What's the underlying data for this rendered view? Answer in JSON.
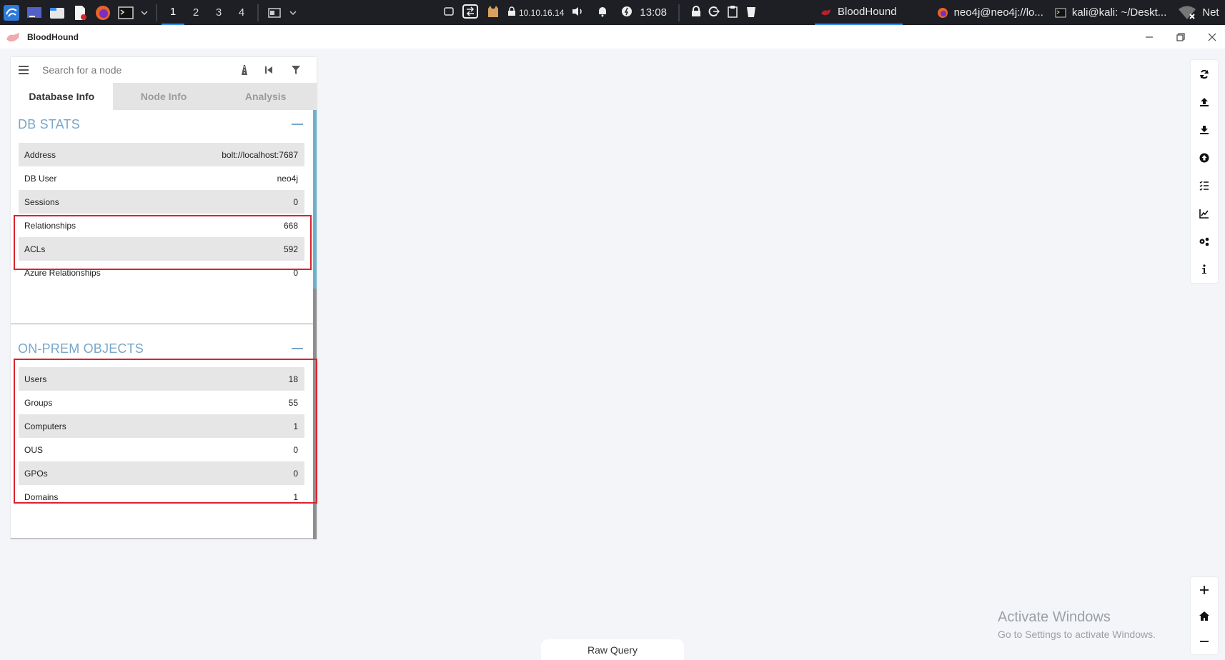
{
  "taskbar": {
    "workspaces": [
      "1",
      "2",
      "3",
      "4"
    ],
    "ip": "10.10.16.14",
    "time": "13:08",
    "tasks": [
      {
        "label": "BloodHound",
        "icon": "bloodhound-icon"
      },
      {
        "label": "neo4j@neo4j://lo...",
        "icon": "firefox-icon"
      },
      {
        "label": "kali@kali: ~/Deskt...",
        "icon": "terminal-icon"
      },
      {
        "label": "Net",
        "icon": "network-icon"
      }
    ]
  },
  "window": {
    "title": "BloodHound"
  },
  "search": {
    "placeholder": "Search for a node"
  },
  "tabs": [
    {
      "label": "Database Info"
    },
    {
      "label": "Node Info"
    },
    {
      "label": "Analysis"
    }
  ],
  "db_stats": {
    "title": "DB STATS",
    "rows": [
      {
        "label": "Address",
        "value": "bolt://localhost:7687"
      },
      {
        "label": "DB User",
        "value": "neo4j"
      },
      {
        "label": "Sessions",
        "value": "0"
      },
      {
        "label": "Relationships",
        "value": "668"
      },
      {
        "label": "ACLs",
        "value": "592"
      },
      {
        "label": "Azure Relationships",
        "value": "0"
      }
    ]
  },
  "onprem": {
    "title": "ON-PREM OBJECTS",
    "rows": [
      {
        "label": "Users",
        "value": "18"
      },
      {
        "label": "Groups",
        "value": "55"
      },
      {
        "label": "Computers",
        "value": "1"
      },
      {
        "label": "OUS",
        "value": "0"
      },
      {
        "label": "GPOs",
        "value": "0"
      },
      {
        "label": "Domains",
        "value": "1"
      }
    ]
  },
  "raw_query": {
    "label": "Raw Query"
  },
  "watermark": {
    "line1": "Activate Windows",
    "line2": "Go to Settings to activate Windows."
  },
  "colors": {
    "accent": "#78a7c9",
    "highlight": "#d9232d",
    "taskbar": "#1d1f24"
  }
}
